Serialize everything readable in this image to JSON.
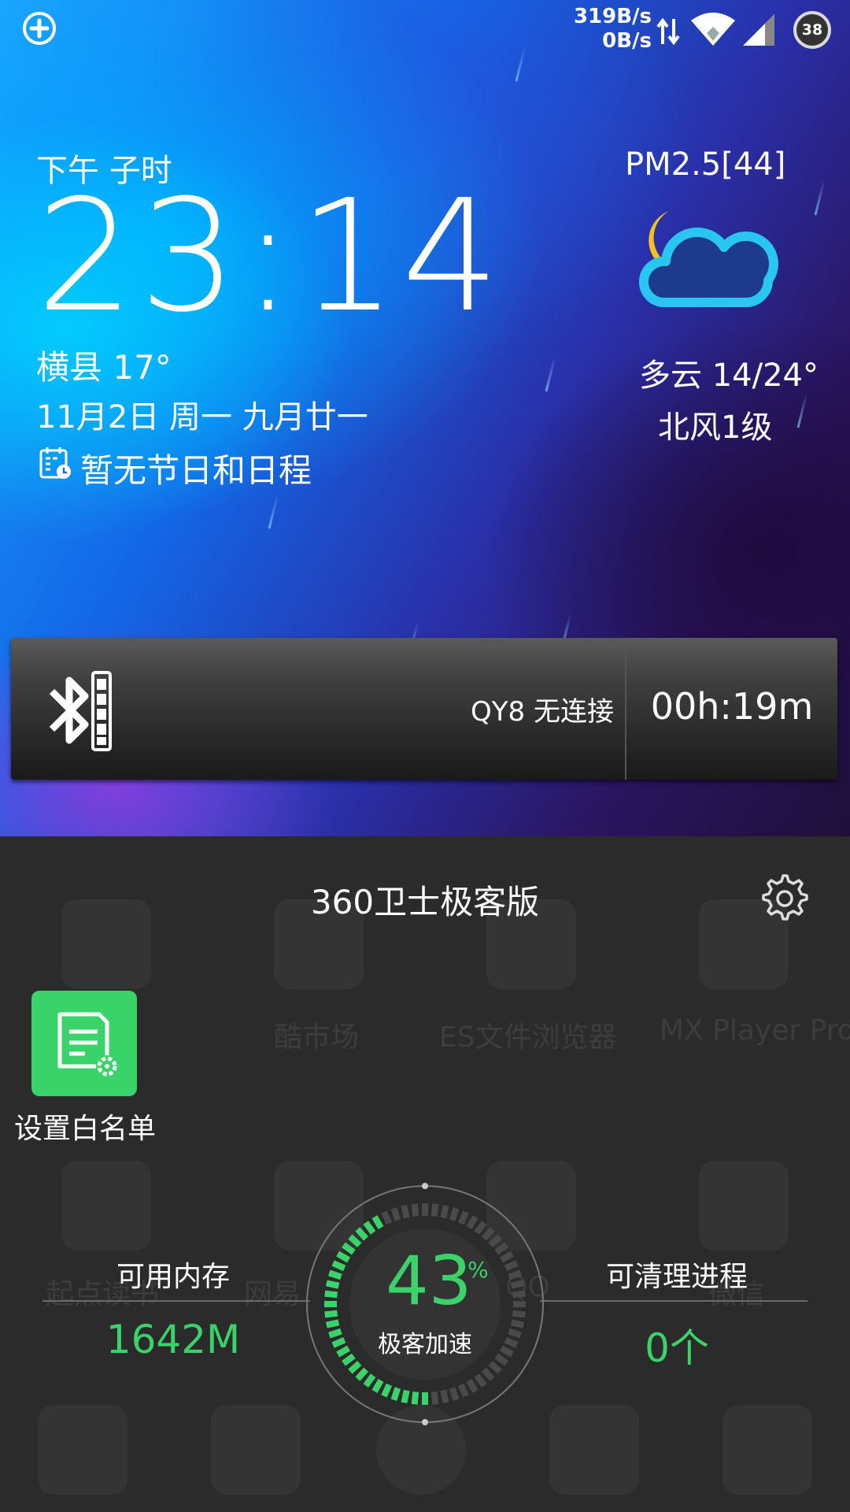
{
  "status_bar": {
    "upload_speed": "319B/s",
    "download_speed": "0B/s",
    "battery_level": "38",
    "icons": [
      "add-circle-icon",
      "data-arrows-icon",
      "wifi-icon",
      "signal-icon",
      "battery-icon"
    ]
  },
  "clock_widget": {
    "period": "下午 子时",
    "time": "23:14",
    "city_temp": "横县 17°",
    "date": "11月2日 周一 九月廿一",
    "schedule": "暂无节日和日程"
  },
  "weather": {
    "pm25": "PM2.5[44]",
    "description": "多云 14/24°",
    "wind": "北风1级",
    "icon": "moon-cloud-icon"
  },
  "bluetooth_widget": {
    "device_status": "QY8 无连接",
    "duration": "00h:19m"
  },
  "speedup_panel": {
    "title": "360卫士极客版",
    "whitelist_label": "设置白名单",
    "memory_label": "可用内存",
    "memory_value": "1642M",
    "process_label": "可清理进程",
    "process_value": "0个",
    "gauge_value": "43",
    "gauge_unit": "%",
    "gauge_label": "极客加速",
    "gauge_percent": 43
  },
  "background_apps": {
    "row1": [
      "酷市场",
      "ES文件浏览器",
      "MX Player Pro"
    ],
    "row2_partial": [
      "起点读书",
      "网易",
      "QQ",
      "微信"
    ]
  },
  "colors": {
    "accent_green": "#3ad36a",
    "weather_cloud": "#29c6f2",
    "weather_moon": "#f5c21b"
  }
}
